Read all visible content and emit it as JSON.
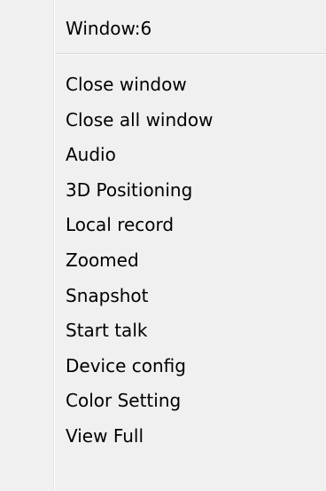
{
  "menu": {
    "header": "Window:6",
    "items": [
      {
        "label": "Close window"
      },
      {
        "label": "Close all window"
      },
      {
        "label": "Audio"
      },
      {
        "label": "3D Positioning"
      },
      {
        "label": "Local record"
      },
      {
        "label": "Zoomed"
      },
      {
        "label": "Snapshot"
      },
      {
        "label": "Start talk"
      },
      {
        "label": "Device config"
      },
      {
        "label": "Color Setting"
      },
      {
        "label": "View Full"
      }
    ]
  },
  "colors": {
    "menu_background": "#f0f0f0",
    "separator": "#d7d7d7",
    "text": "#000000"
  }
}
